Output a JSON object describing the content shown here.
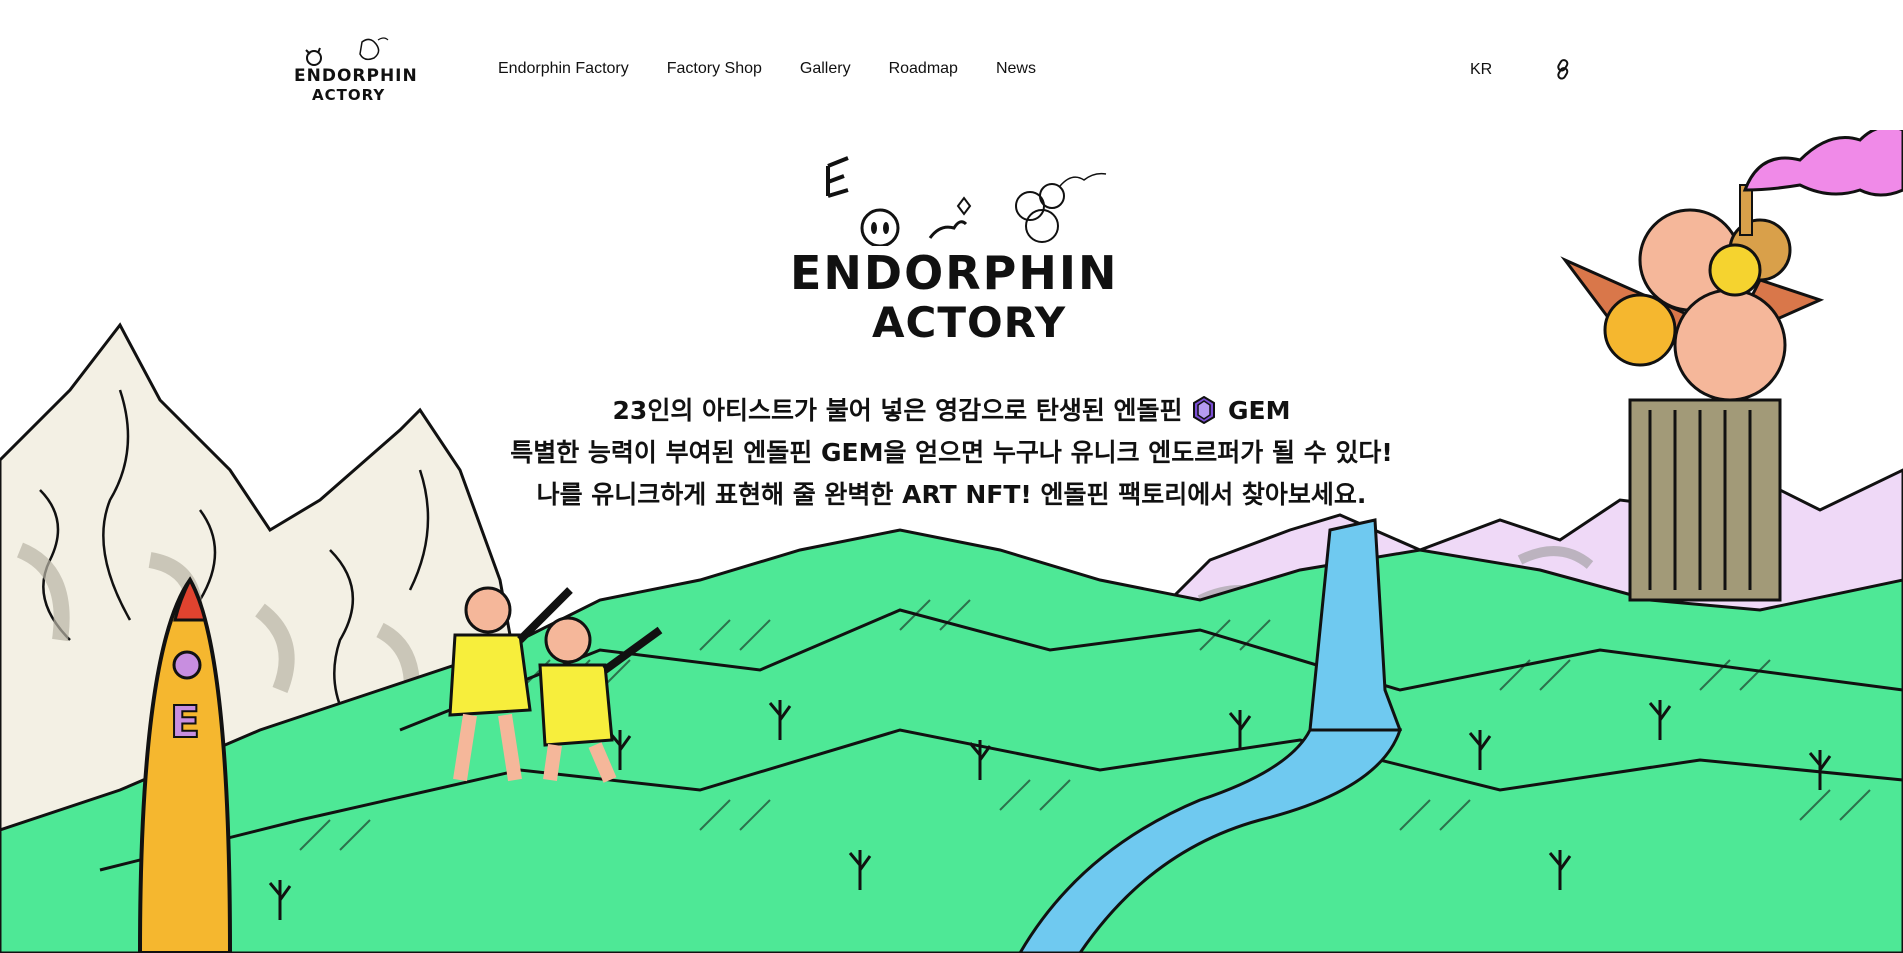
{
  "brand": {
    "logo_line1": "ENDORPHIN",
    "logo_line2": "ACTORY"
  },
  "nav": {
    "items": [
      {
        "label": "Endorphin Factory"
      },
      {
        "label": "Factory Shop"
      },
      {
        "label": "Gallery"
      },
      {
        "label": "Roadmap"
      },
      {
        "label": "News"
      }
    ],
    "lang": "KR",
    "link_icon": "link-icon"
  },
  "hero": {
    "logo_line1": "ENDORPHIN",
    "logo_line2": "ACTORY",
    "line1_text": "23인의 아티스트가 불어 넣은 영감으로 탄생된 엔돌핀",
    "line1_gem": "GEM",
    "line2": "특별한 능력이 부여된 엔돌핀 GEM을 얻으면 누구나 유니크 엔도르퍼가 될 수 있다!",
    "line3": "나를 유니크하게 표현해 줄 완벽한 ART NFT! 엔돌핀 팩토리에서 찾아보세요."
  },
  "colors": {
    "grass": "#4ee896",
    "snow": "#f3f0e4",
    "pink_mountain": "#efd9f7",
    "water": "#6fc9f0",
    "smoke": "#f08ae8",
    "rocket": "#f5b72f",
    "shirt": "#f7ee3c",
    "gem": "#7b4fd6"
  }
}
